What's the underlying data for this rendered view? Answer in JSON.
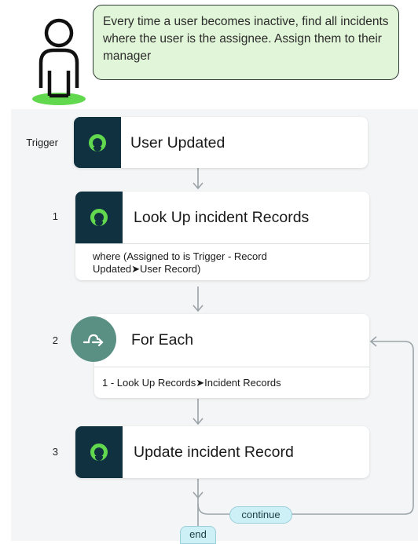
{
  "annotation": {
    "text": "Every time a user becomes inactive, find all incidents where the user is the assignee. Assign them to their manager"
  },
  "flow": {
    "trigger": {
      "label": "Trigger",
      "title": "User Updated",
      "icon": "record-icon"
    },
    "steps": [
      {
        "number": "1",
        "title": "Look Up incident Records",
        "detail": "where (Assigned to is Trigger - Record Updated➤User Record)",
        "icon": "record-icon"
      },
      {
        "number": "2",
        "title": "For Each",
        "detail": "1 - Look Up Records➤Incident Records",
        "icon": "loop-icon"
      },
      {
        "number": "3",
        "title": "Update incident Record",
        "icon": "record-icon"
      }
    ],
    "continue_label": "continue",
    "end_label": "end"
  },
  "colors": {
    "bubble_fill": "#e1f5d8",
    "icon_dark": "#0f3140",
    "icon_green": "#62d84e",
    "foreach": "#5a8f83",
    "pill": "#cdeff6",
    "person_base": "#62d84e"
  }
}
